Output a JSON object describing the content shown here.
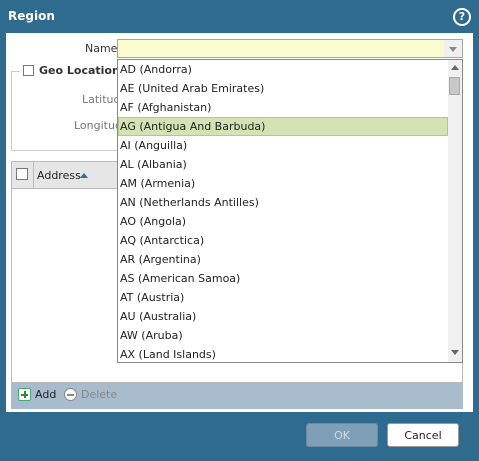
{
  "dialog": {
    "title": "Region",
    "help_icon": "?"
  },
  "form": {
    "name_label": "Name",
    "name_value": "",
    "geo_location_label": "Geo Location",
    "latitude_label": "Latitude",
    "longitude_label": "Longitude"
  },
  "table": {
    "column_address": "Address",
    "sort": "ascending"
  },
  "toolbar": {
    "add_label": "Add",
    "delete_label": "Delete"
  },
  "buttons": {
    "ok_label": "OK",
    "cancel_label": "Cancel"
  },
  "dropdown": {
    "items": [
      "AD (Andorra)",
      "AE (United Arab Emirates)",
      "AF (Afghanistan)",
      "AG (Antigua And Barbuda)",
      "AI (Anguilla)",
      "AL (Albania)",
      "AM (Armenia)",
      "AN (Netherlands Antilles)",
      "AO (Angola)",
      "AQ (Antarctica)",
      "AR (Argentina)",
      "AS (American Samoa)",
      "AT (Austria)",
      "AU (Australia)",
      "AW (Aruba)",
      "AX (Land Islands)"
    ],
    "selected": "AG (Antigua And Barbuda)"
  },
  "colors": {
    "frame": "#2e6b8f",
    "name_input_bg": "#fbfbd0",
    "selected_item_bg": "#d7e2b4",
    "toolbar_bg": "#a9bccd"
  }
}
